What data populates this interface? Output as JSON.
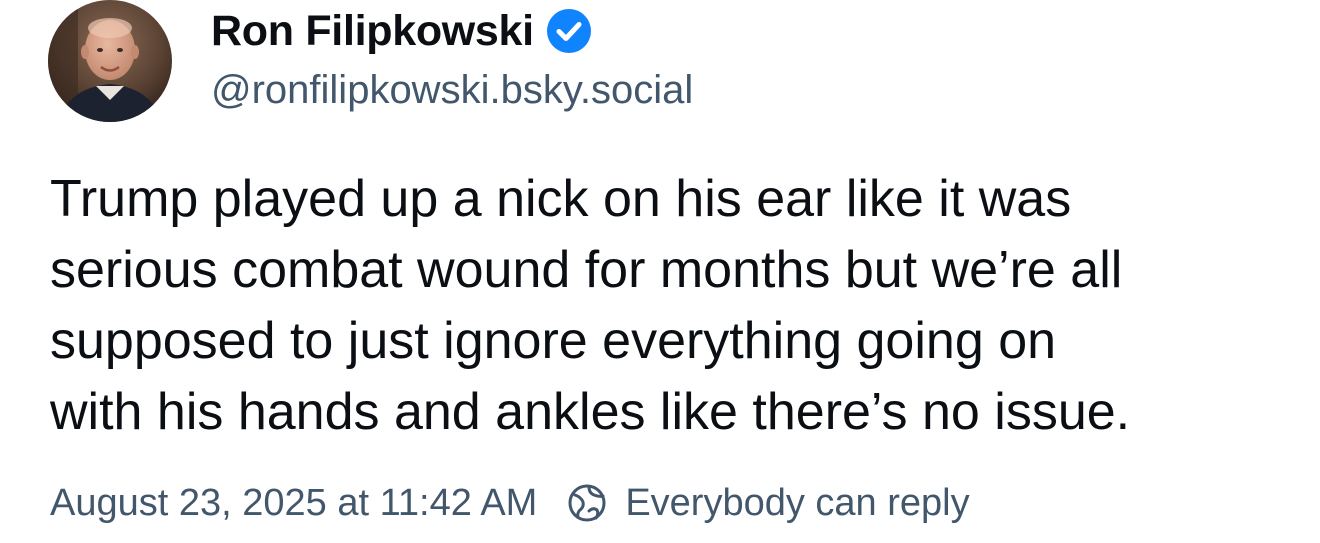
{
  "author": {
    "display_name": "Ron Filipkowski",
    "handle": "@ronfilipkowski.bsky.social",
    "verified": true,
    "verified_color": "#1083fe"
  },
  "post": {
    "lines": [
      "Trump played up a nick on his ear like it was",
      "serious combat wound for months but we’re all",
      "supposed to just ignore everything going on",
      "with his hands and ankles like there’s no issue."
    ]
  },
  "meta": {
    "timestamp": "August 23, 2025 at 11:42 AM",
    "reply_setting": "Everybody can reply",
    "reply_icon": "earth-icon"
  },
  "colors": {
    "text": "#0b0f14",
    "secondary": "#42576c"
  }
}
